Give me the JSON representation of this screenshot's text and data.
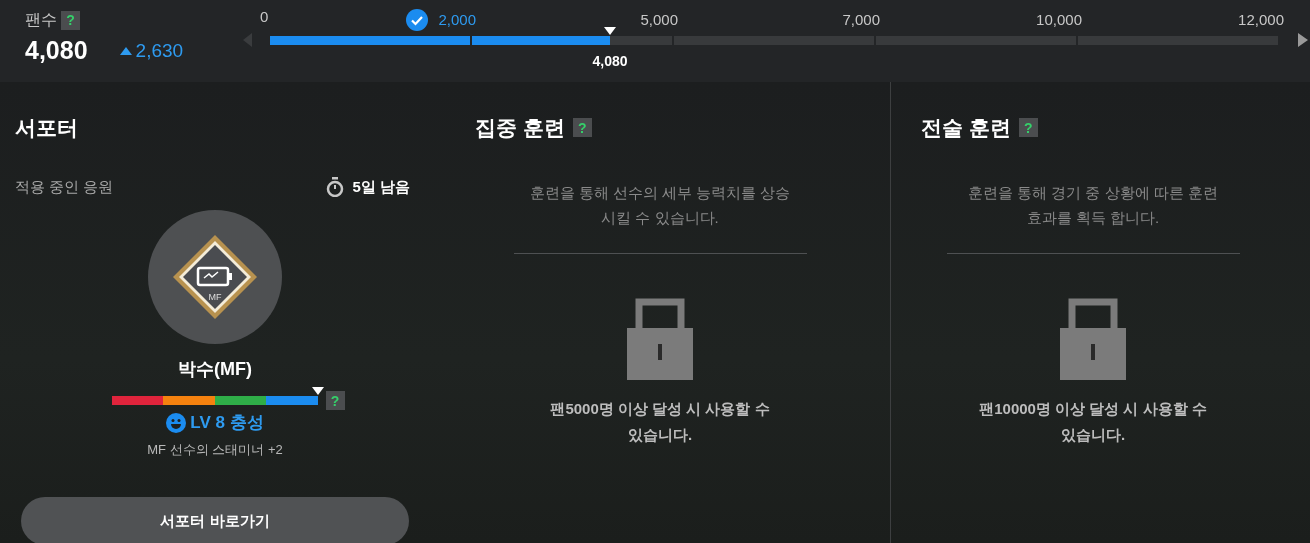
{
  "fans": {
    "label": "팬수",
    "help": "?",
    "count": "4,080",
    "increase": "2,630"
  },
  "progress": {
    "start_label": "0",
    "current_label": "4,080",
    "tiers": [
      {
        "label": "2,000",
        "reached": true,
        "level": 1
      },
      {
        "label": "5,000",
        "reached": false,
        "level": 0.69
      },
      {
        "label": "7,000",
        "reached": false,
        "level": 0
      },
      {
        "label": "10,000",
        "reached": false,
        "level": 0
      },
      {
        "label": "12,000",
        "reached": false,
        "level": 0
      }
    ]
  },
  "supporter": {
    "title": "서포터",
    "applied_label": "적용 중인 응원",
    "remaining": "5일 남음",
    "badge_position": "MF",
    "name": "박수(MF)",
    "level": 1,
    "help": "?",
    "loyalty": "LV 8 충성",
    "effect": "MF 선수의 스태미너 +2",
    "button": "서포터 바로가기"
  },
  "trainings": [
    {
      "title": "집중 훈련",
      "help": "?",
      "description": "훈련을 통해 선수의 세부 능력치를 상승 시킬 수 있습니다.",
      "locked": true,
      "lock_message": "팬5000명 이상 달성 시 사용할 수 있습니다."
    },
    {
      "title": "전술 훈련",
      "help": "?",
      "description": "훈련을 통해 경기 중 상황에 따른 훈련 효과를 획득 합니다.",
      "locked": true,
      "lock_message": "팬10000명 이상 달성 시 사용할 수 있습니다."
    }
  ]
}
